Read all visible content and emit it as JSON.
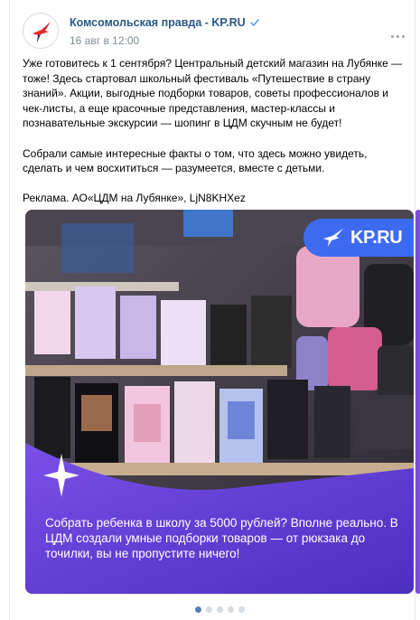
{
  "post": {
    "author": "Комсомольская правда - KP.RU",
    "date": "16 авг в 12:00",
    "text_p1": "Уже готовитесь к 1 сентября? Центральный детский магазин на Лубянке — тоже! Здесь стартовал школьный фестиваль «Путешествие в страну знаний». Акции, выгодные подборки товаров, советы профессионалов и чек-листы, а еще красочные представления, мастер-классы и познавательные экскурсии — шопинг в ЦДМ скучным не будет!",
    "text_p2": "Собрали самые интересные факты о том, что здесь можно увидеть, сделать и чем восхититься — разумеется, вместе с детьми.",
    "text_p3": "Реклама. АО«ЦДМ на Лубянке», LjN8KHXez"
  },
  "media": {
    "logo_text": "KP.RU",
    "caption": "Собрать ребенка в школу за 5000 рублей? Вполне реально. В ЦДМ создали умные подборки товаров — от рюкзака до точилки, вы не пропустите ничего!",
    "accent_color": "#3d6bf0",
    "banner_color": "#6a3fd8"
  },
  "carousel": {
    "total": 5,
    "active_index": 0
  }
}
